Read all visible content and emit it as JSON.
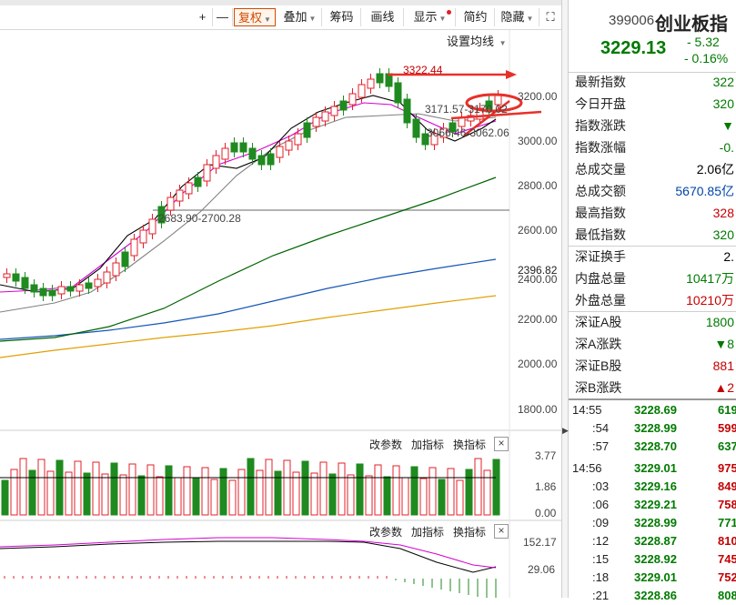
{
  "toolbar": {
    "plus": "+",
    "minus": "—",
    "fuquan": "复权",
    "diejia": "叠加",
    "choumа": "筹码",
    "huaxian": "画线",
    "xianshi": "显示",
    "jianyue": "简约",
    "yincang": "隐藏",
    "colors": {
      "accent": "#d04a00"
    }
  },
  "chart": {
    "ma_setting": "设置均线",
    "high_label": "3322.44",
    "range1_label": "3171.57-3170.02",
    "range2_label": "3066.46-3062.06",
    "low_range_label": "2683.90-2700.28",
    "last_label": "2396.82",
    "yaxis": [
      "3200.00",
      "3000.00",
      "2800.00",
      "2600.00",
      "2400.00",
      "2200.00",
      "2000.00",
      "1800.00"
    ],
    "volume": {
      "change_param": "改参数",
      "add_indicator": "加指标",
      "switch_indicator": "换指标",
      "close": "×",
      "y_top": "3.77",
      "y_mid": "1.86",
      "y_bot": "0.00"
    },
    "macd": {
      "change_param": "改参数",
      "add_indicator": "加指标",
      "switch_indicator": "换指标",
      "close": "×",
      "y_top": "152.17",
      "y_mid": "29.06"
    },
    "colors": {
      "up": "#e0202a",
      "down": "#1f8a1f",
      "ma5": "#000000",
      "ma10": "#d400d4",
      "ma20": "#808080",
      "ma60": "#006400",
      "ma120": "#1455b8",
      "ma250": "#e0a000",
      "annotation": "#e8302a"
    }
  },
  "splitter": {
    "arrow": "▶"
  },
  "panel": {
    "code": "399006",
    "name": "创业板指",
    "price": "3229.13",
    "change": "- 5.32",
    "change_pct": "- 0.16%",
    "stats": [
      {
        "label": "最新指数",
        "value": "322",
        "color": "green"
      },
      {
        "label": "今日开盘",
        "value": "320",
        "color": "green"
      },
      {
        "label": "指数涨跌",
        "value": "▼",
        "color": "green"
      },
      {
        "label": "指数涨幅",
        "value": "-0.",
        "color": "green"
      },
      {
        "label": "总成交量",
        "value": "2.06亿",
        "color": "black"
      },
      {
        "label": "总成交额",
        "value": "5670.85亿",
        "color": "blue"
      },
      {
        "label": "最高指数",
        "value": "328",
        "color": "red"
      },
      {
        "label": "最低指数",
        "value": "320",
        "color": "green"
      }
    ],
    "stats2": [
      {
        "label": "深证换手",
        "value": "2.",
        "color": "black"
      },
      {
        "label": "内盘总量",
        "value": "10417万",
        "color": "green"
      },
      {
        "label": "外盘总量",
        "value": "10210万",
        "color": "red"
      }
    ],
    "stats3": [
      {
        "label": "深证A股",
        "value": "1800",
        "color": "green"
      },
      {
        "label": "深A涨跌",
        "value": "▼8",
        "color": "green"
      },
      {
        "label": "深证B股",
        "value": "881",
        "color": "red"
      },
      {
        "label": "深B涨跌",
        "value": "▲2",
        "color": "red"
      }
    ],
    "ticks": [
      {
        "t": "14:55",
        "p": "3228.69",
        "v": "619",
        "c": "green"
      },
      {
        "t": ":54",
        "p": "3228.99",
        "v": "599",
        "c": "red"
      },
      {
        "t": ":57",
        "p": "3228.70",
        "v": "637",
        "c": "green"
      },
      {
        "t": "14:56",
        "p": "3229.01",
        "v": "975",
        "c": "red"
      },
      {
        "t": ":03",
        "p": "3229.16",
        "v": "849",
        "c": "red"
      },
      {
        "t": ":06",
        "p": "3229.21",
        "v": "758",
        "c": "red"
      },
      {
        "t": ":09",
        "p": "3228.99",
        "v": "771",
        "c": "green"
      },
      {
        "t": ":12",
        "p": "3228.87",
        "v": "810",
        "c": "red"
      },
      {
        "t": ":15",
        "p": "3228.92",
        "v": "745",
        "c": "red"
      },
      {
        "t": ":18",
        "p": "3229.01",
        "v": "752",
        "c": "red"
      },
      {
        "t": ":21",
        "p": "3228.86",
        "v": "808",
        "c": "green"
      }
    ]
  }
}
